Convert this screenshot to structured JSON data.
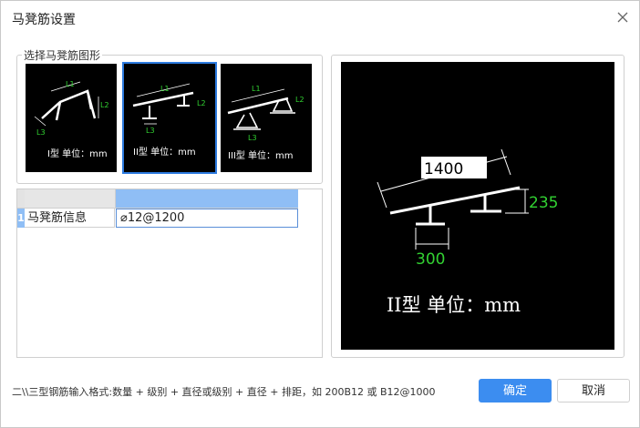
{
  "window": {
    "title": "马凳筋设置"
  },
  "shape_group": {
    "legend": "选择马凳筋图形",
    "shapes": [
      {
        "caption": "I型 单位：mm",
        "l1": "L1",
        "l2": "L2",
        "l3": "L3",
        "selected": false
      },
      {
        "caption": "II型 单位：mm",
        "l1": "L1",
        "l2": "L2",
        "l3": "L3",
        "selected": true
      },
      {
        "caption": "III型 单位：mm",
        "l1": "L1",
        "l2": "L2",
        "l3": "L3",
        "selected": false
      }
    ]
  },
  "grid": {
    "row_number": "1",
    "label": "马凳筋信息",
    "value": "⌀12@1200"
  },
  "preview": {
    "l1_value": "1400",
    "l2_value": "235",
    "l3_value": "300",
    "caption": "II型 单位：mm"
  },
  "footer": {
    "hint": "二\\\\三型钢筋输入格式:数量 + 级别 + 直径或级别 + 直径 + 排距，如 200B12 或 B12@1000"
  },
  "buttons": {
    "ok": "确定",
    "cancel": "取消"
  },
  "colors": {
    "accent": "#3c8df0",
    "dimension_green": "#32d232",
    "canvas": "#000000",
    "selected_header": "#8fbef5"
  }
}
